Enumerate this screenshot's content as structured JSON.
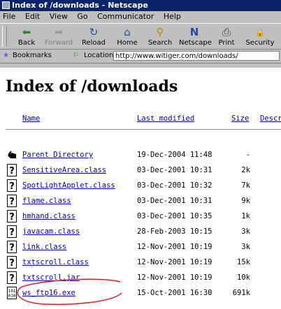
{
  "window": {
    "title": "Index of /downloads - Netscape"
  },
  "menu": [
    "File",
    "Edit",
    "View",
    "Go",
    "Communicator",
    "Help"
  ],
  "toolbar": [
    {
      "label": "Back",
      "icon": "back-arrow-icon",
      "glyph": "⬅",
      "disabled": false
    },
    {
      "label": "Forward",
      "icon": "forward-arrow-icon",
      "glyph": "➡",
      "disabled": true
    },
    {
      "label": "Reload",
      "icon": "reload-icon",
      "glyph": "↻",
      "disabled": false
    },
    {
      "label": "Home",
      "icon": "home-icon",
      "glyph": "⌂",
      "disabled": false
    },
    {
      "label": "Search",
      "icon": "search-icon",
      "glyph": "⚲",
      "disabled": false
    },
    {
      "label": "Netscape",
      "icon": "netscape-icon",
      "glyph": "N",
      "disabled": false
    },
    {
      "label": "Print",
      "icon": "printer-icon",
      "glyph": "⎙",
      "disabled": false
    },
    {
      "label": "Security",
      "icon": "padlock-icon",
      "glyph": "🔒",
      "disabled": false
    }
  ],
  "location": {
    "bookmarks_label": "Bookmarks",
    "location_label": "Location:",
    "url": "http://www.witiger.com/downloads/"
  },
  "page": {
    "heading": "Index of /downloads",
    "columns": {
      "name": "Name",
      "modified": "Last modified",
      "size": "Size",
      "description": "Descr"
    },
    "rows": [
      {
        "name": "Parent Directory",
        "modified": "19-Dec-2004 11:48",
        "size": "-",
        "icon": "parent-directory-icon"
      },
      {
        "name": "SensitiveArea.class",
        "modified": "03-Dec-2001 10:31",
        "size": "2k",
        "icon": "unknown-file-icon"
      },
      {
        "name": "SpotLightApplet.class",
        "modified": "03-Dec-2001 10:32",
        "size": "7k",
        "icon": "unknown-file-icon"
      },
      {
        "name": "flame.class",
        "modified": "03-Dec-2001 10:31",
        "size": "9k",
        "icon": "unknown-file-icon"
      },
      {
        "name": "hmhand.class",
        "modified": "03-Dec-2001 10:35",
        "size": "1k",
        "icon": "unknown-file-icon"
      },
      {
        "name": "javacam.class",
        "modified": "28-Feb-2003 10:15",
        "size": "3k",
        "icon": "unknown-file-icon"
      },
      {
        "name": "link.class",
        "modified": "12-Nov-2001 10:19",
        "size": "3k",
        "icon": "unknown-file-icon"
      },
      {
        "name": "txtscroll.class",
        "modified": "12-Nov-2001 10:19",
        "size": "15k",
        "icon": "unknown-file-icon"
      },
      {
        "name": "txtscroll.jar",
        "modified": "12-Nov-2001 10:19",
        "size": "10k",
        "icon": "unknown-file-icon"
      },
      {
        "name": "ws_ftp16.exe",
        "modified": "15-Oct-2001 16:30",
        "size": "691k",
        "icon": "binary-file-icon"
      }
    ]
  },
  "colors": {
    "link": "#0000cc",
    "titlebar": "#0a246a",
    "annotation": "#d42020"
  }
}
